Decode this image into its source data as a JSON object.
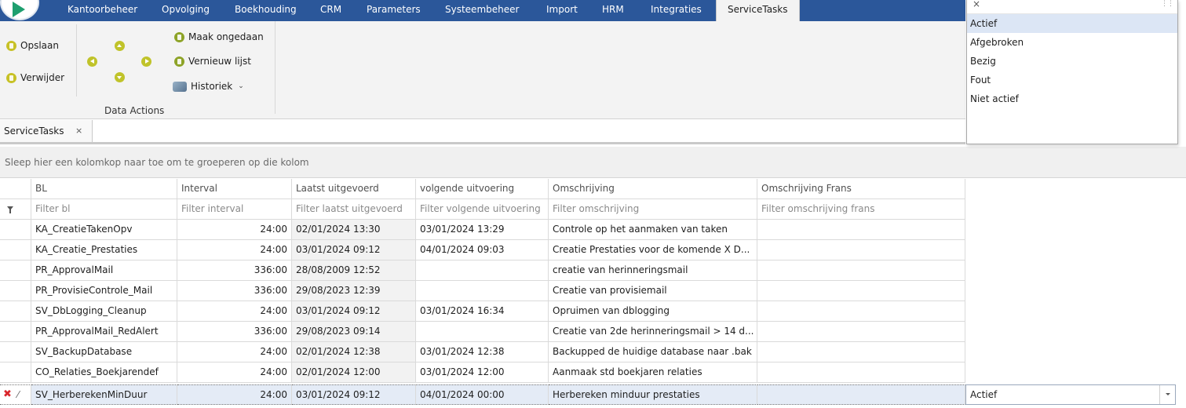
{
  "menu": {
    "items": [
      "Kantoorbeheer",
      "Opvolging",
      "Boekhouding",
      "CRM",
      "Parameters",
      "Systeembeheer",
      "Import",
      "HRM",
      "Integraties",
      "ServiceTasks"
    ],
    "active": "ServiceTasks"
  },
  "ribbon": {
    "save": "Opslaan",
    "delete": "Verwijder",
    "undo": "Maak ongedaan",
    "refresh": "Vernieuw lijst",
    "history": "Historiek",
    "group_label": "Data Actions"
  },
  "doc_tab": {
    "label": "ServiceTasks",
    "close": "×"
  },
  "grid": {
    "group_hint": "Sleep hier een kolomkop naar toe om te groeperen op die kolom",
    "columns": [
      "BL",
      "Interval",
      "Laatst uitgevoerd",
      "volgende uitvoering",
      "Omschrijving",
      "Omschrijving Frans"
    ],
    "filters": [
      "Filter bl",
      "Filter interval",
      "Filter laatst uitgevoerd",
      "Filter volgende uitvoering",
      "Filter omschrijving",
      "Filter omschrijving frans"
    ],
    "rows": [
      {
        "bl": "KA_CreatieTakenOpv",
        "interval": "24:00",
        "last": "02/01/2024 13:30",
        "next": "03/01/2024 13:29",
        "desc": "Controle op het aanmaken van taken",
        "desc_fr": ""
      },
      {
        "bl": "KA_Creatie_Prestaties",
        "interval": "24:00",
        "last": "03/01/2024 09:12",
        "next": "04/01/2024 09:03",
        "desc": "Creatie Prestaties voor de komende X D...",
        "desc_fr": ""
      },
      {
        "bl": "PR_ApprovalMail",
        "interval": "336:00",
        "last": "28/08/2009 12:52",
        "next": "",
        "desc": "creatie van herinneringsmail",
        "desc_fr": ""
      },
      {
        "bl": "PR_ProvisieControle_Mail",
        "interval": "336:00",
        "last": "29/08/2023 12:39",
        "next": "",
        "desc": "Creatie van provisiemail",
        "desc_fr": ""
      },
      {
        "bl": "SV_DbLogging_Cleanup",
        "interval": "24:00",
        "last": "03/01/2024 09:12",
        "next": "03/01/2024 16:34",
        "desc": "Opruimen van dblogging",
        "desc_fr": ""
      },
      {
        "bl": "PR_ApprovalMail_RedAlert",
        "interval": "336:00",
        "last": "29/08/2023 09:14",
        "next": "",
        "desc": "Creatie van 2de herinneringsmail > 14 d...",
        "desc_fr": ""
      },
      {
        "bl": "SV_BackupDatabase",
        "interval": "24:00",
        "last": "02/01/2024 12:38",
        "next": "03/01/2024 12:38",
        "desc": "Backupped de huidige database naar .bak",
        "desc_fr": ""
      },
      {
        "bl": "CO_Relaties_Boekjarendef",
        "interval": "24:00",
        "last": "02/01/2024 12:00",
        "next": "03/01/2024 12:00",
        "desc": "Aanmaak std boekjaren relaties",
        "desc_fr": ""
      },
      {
        "bl": "SV_HerberekenMinDuur",
        "interval": "24:00",
        "last": "03/01/2024 09:12",
        "next": "04/01/2024 00:00",
        "desc": "Herbereken minduur prestaties",
        "desc_fr": "",
        "status": "Actief"
      }
    ]
  },
  "dropdown": {
    "close": "×",
    "options": [
      "Actief",
      "Afgebroken",
      "Bezig",
      "Fout",
      "Niet actief"
    ],
    "selected": "Actief"
  }
}
